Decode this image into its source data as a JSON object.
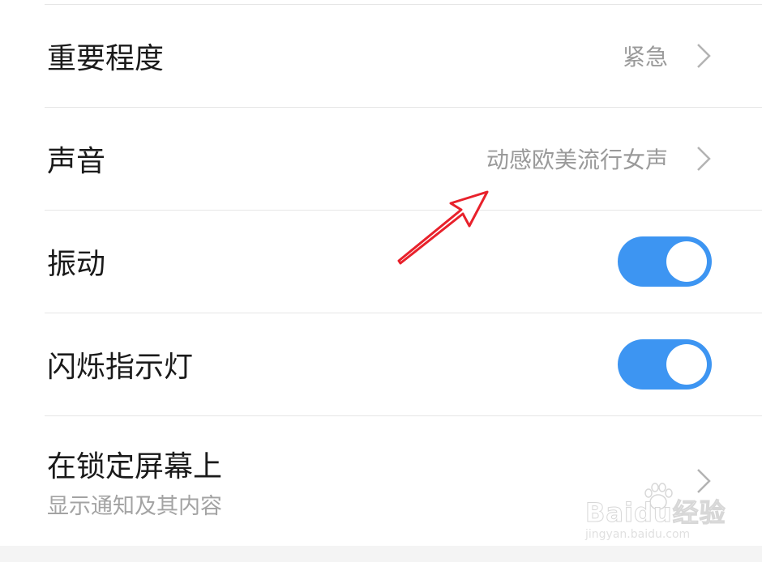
{
  "settings": {
    "importance": {
      "label": "重要程度",
      "value": "紧急"
    },
    "sound": {
      "label": "声音",
      "value": "动感欧美流行女声"
    },
    "vibration": {
      "label": "振动",
      "enabled": true
    },
    "flash_light": {
      "label": "闪烁指示灯",
      "enabled": true
    },
    "lock_screen": {
      "label": "在锁定屏幕上",
      "subtitle": "显示通知及其内容"
    }
  },
  "watermark": {
    "brand": "Baidu经验",
    "url": "jingyan.baidu.com"
  },
  "colors": {
    "toggle_on": "#3d95f2",
    "annotation_arrow": "#e8212b",
    "value_text": "#9a9a9a"
  },
  "icons": {
    "chevron": "chevron-right-icon",
    "arrow": "annotation-arrow"
  }
}
